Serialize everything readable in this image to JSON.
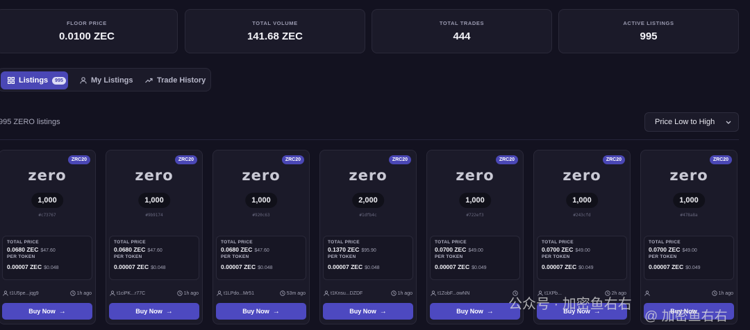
{
  "stats": [
    {
      "label": "FLOOR PRICE",
      "value": "0.0100 ZEC"
    },
    {
      "label": "TOTAL VOLUME",
      "value": "141.68 ZEC"
    },
    {
      "label": "TOTAL TRADES",
      "value": "444"
    },
    {
      "label": "ACTIVE LISTINGS",
      "value": "995"
    }
  ],
  "tabs": {
    "listings": {
      "label": "Listings",
      "badge": "995"
    },
    "my_listings": {
      "label": "My Listings"
    },
    "trade_history": {
      "label": "Trade History"
    }
  },
  "listing_count": "995 ZERO listings",
  "sort": {
    "selected": "Price Low to High"
  },
  "card_labels": {
    "total_price": "TOTAL PRICE",
    "per_token": "PER TOKEN",
    "buy": "Buy Now",
    "tag": "ZRC20",
    "logo": "zero"
  },
  "cards": [
    {
      "amount": "1,000",
      "hash": "#c73767",
      "total_zec": "0.0680 ZEC",
      "total_usd": "$47.60",
      "per_zec": "0.00007 ZEC",
      "per_usd": "$0.048",
      "seller": "t1U5pe...jqg9",
      "time": "1h ago"
    },
    {
      "amount": "1,000",
      "hash": "#9b9174",
      "total_zec": "0.0680 ZEC",
      "total_usd": "$47.60",
      "per_zec": "0.00007 ZEC",
      "per_usd": "$0.048",
      "seller": "t1ciPK...r77C",
      "time": "1h ago"
    },
    {
      "amount": "1,000",
      "hash": "#920c63",
      "total_zec": "0.0680 ZEC",
      "total_usd": "$47.60",
      "per_zec": "0.00007 ZEC",
      "per_usd": "$0.048",
      "seller": "t1LPdo...Mr51",
      "time": "53m ago"
    },
    {
      "amount": "2,000",
      "hash": "#1dfb4c",
      "total_zec": "0.1370 ZEC",
      "total_usd": "$95.90",
      "per_zec": "0.00007 ZEC",
      "per_usd": "$0.048",
      "seller": "t1Knsu...DZDF",
      "time": "1h ago"
    },
    {
      "amount": "1,000",
      "hash": "#722ef3",
      "total_zec": "0.0700 ZEC",
      "total_usd": "$49.00",
      "per_zec": "0.00007 ZEC",
      "per_usd": "$0.049",
      "seller": "t1ZobF...owNN",
      "time": ""
    },
    {
      "amount": "1,000",
      "hash": "#243cfd",
      "total_zec": "0.0700 ZEC",
      "total_usd": "$49.00",
      "per_zec": "0.00007 ZEC",
      "per_usd": "$0.049",
      "seller": "t1XPb...",
      "time": "2h ago"
    },
    {
      "amount": "1,000",
      "hash": "#478a8a",
      "total_zec": "0.0700 ZEC",
      "total_usd": "$49.00",
      "per_zec": "0.00007 ZEC",
      "per_usd": "$0.049",
      "seller": "",
      "time": "1h ago"
    }
  ],
  "watermark": {
    "line1": "公众号 · 加密鱼右右",
    "line2": "@ 加密鱼右右"
  }
}
